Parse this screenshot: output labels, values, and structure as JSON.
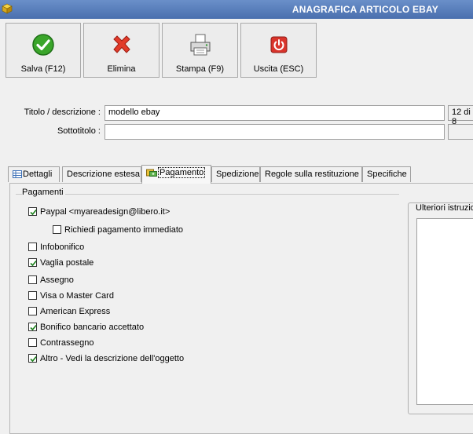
{
  "window": {
    "title": "ANAGRAFICA ARTICOLO EBAY",
    "icon": "app-cube-icon"
  },
  "toolbar": {
    "save": {
      "label": "Salva (F12)",
      "icon": "checkmark-icon",
      "color": "#3aa52a"
    },
    "delete": {
      "label": "Elimina",
      "icon": "red-x-icon",
      "color": "#e23b2a"
    },
    "print": {
      "label": "Stampa (F9)",
      "icon": "printer-icon"
    },
    "exit": {
      "label": "Uscita (ESC)",
      "icon": "power-icon",
      "color": "#d9342b"
    }
  },
  "form": {
    "title_label": "Titolo / descrizione :",
    "title_value": "modello ebay",
    "title_counter": "12 di 8",
    "subtitle_label": "Sottotitolo :",
    "subtitle_value": ""
  },
  "tabs": [
    {
      "label": "Dettagli",
      "icon": "grid-icon"
    },
    {
      "label": "Descrizione estesa"
    },
    {
      "label": "Pagamento",
      "icon": "payment-icon",
      "active": true
    },
    {
      "label": "Spedizione"
    },
    {
      "label": "Regole sulla restituzione"
    },
    {
      "label": "Specifiche"
    }
  ],
  "payments": {
    "group_title": "Pagamenti",
    "items": [
      {
        "label": "Paypal <myareadesign@libero.it>",
        "checked": true
      },
      {
        "label": "Richiedi pagamento immediato",
        "checked": false,
        "indent": true
      },
      {
        "label": "Infobonifico",
        "checked": false
      },
      {
        "label": "Vaglia postale",
        "checked": true
      },
      {
        "label": "Assegno",
        "checked": false
      },
      {
        "label": "Visa o Master Card",
        "checked": false
      },
      {
        "label": "American Express",
        "checked": false
      },
      {
        "label": "Bonifico bancario accettato",
        "checked": true
      },
      {
        "label": "Contrassegno",
        "checked": false
      },
      {
        "label": "Altro - Vedi la descrizione dell'oggetto",
        "checked": true
      }
    ]
  },
  "notes": {
    "title": "Ulteriori istruzio",
    "value": ""
  }
}
